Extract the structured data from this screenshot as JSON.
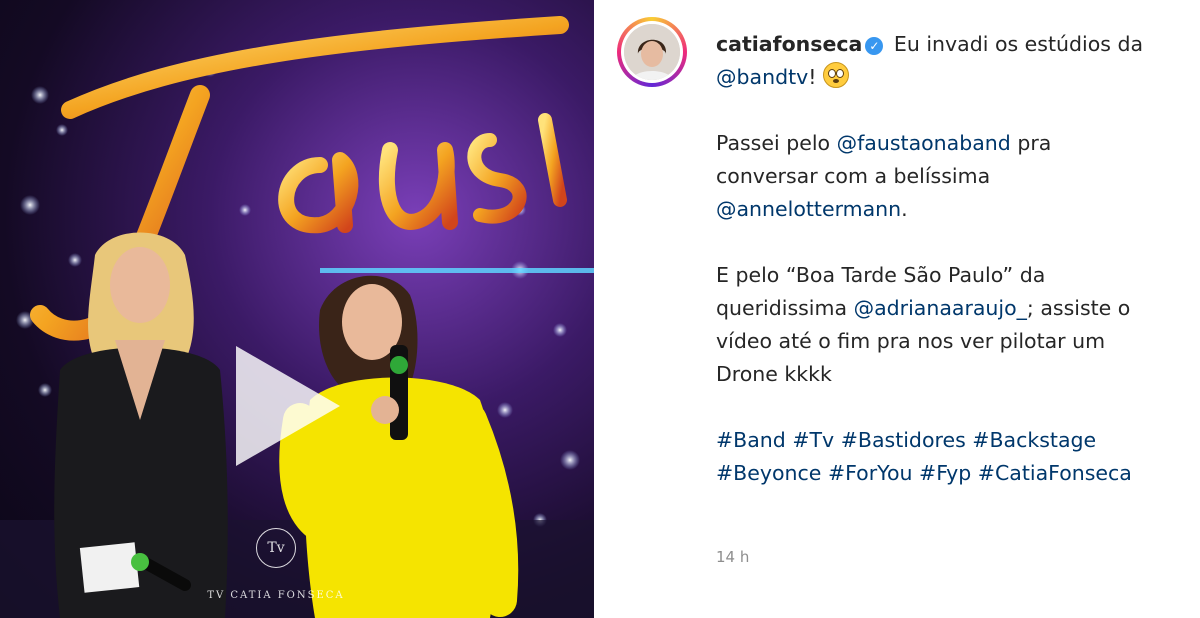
{
  "media": {
    "watermark_logo": "Tv",
    "watermark_text": "TV CATIA FONSECA",
    "play_icon": "play-icon"
  },
  "post": {
    "username": "catiafonseca",
    "verified_icon": "verified-badge-icon",
    "line1_text": "Eu invadi os estúdios",
    "line2_prefix": "da ",
    "mention_bandtv": "@bandtv",
    "line2_suffix": "!",
    "emoji": "flushed-face-emoji",
    "p2_prefix": "Passei pelo ",
    "mention_faustao": "@faustaonaband",
    "p2_mid": " pra conversar com a belíssima ",
    "mention_anne": "@annelottermann",
    "p2_suffix": ".",
    "p3_prefix": "E pelo “Boa Tarde São Paulo” da queridissima ",
    "mention_adriana": "@adrianaaraujo_",
    "p3_suffix": "; assiste o vídeo até o fim pra nos ver pilotar um Drone kkkk",
    "hashtags": [
      "#Band",
      "#Tv",
      "#Bastidores",
      "#Backstage",
      "#Beyonce",
      "#ForYou",
      "#Fyp",
      "#CatiaFonseca"
    ],
    "timestamp": "14 h"
  },
  "colors": {
    "link": "#00376b",
    "text": "#262626",
    "muted": "#8e8e8e",
    "verified": "#3897f0"
  }
}
